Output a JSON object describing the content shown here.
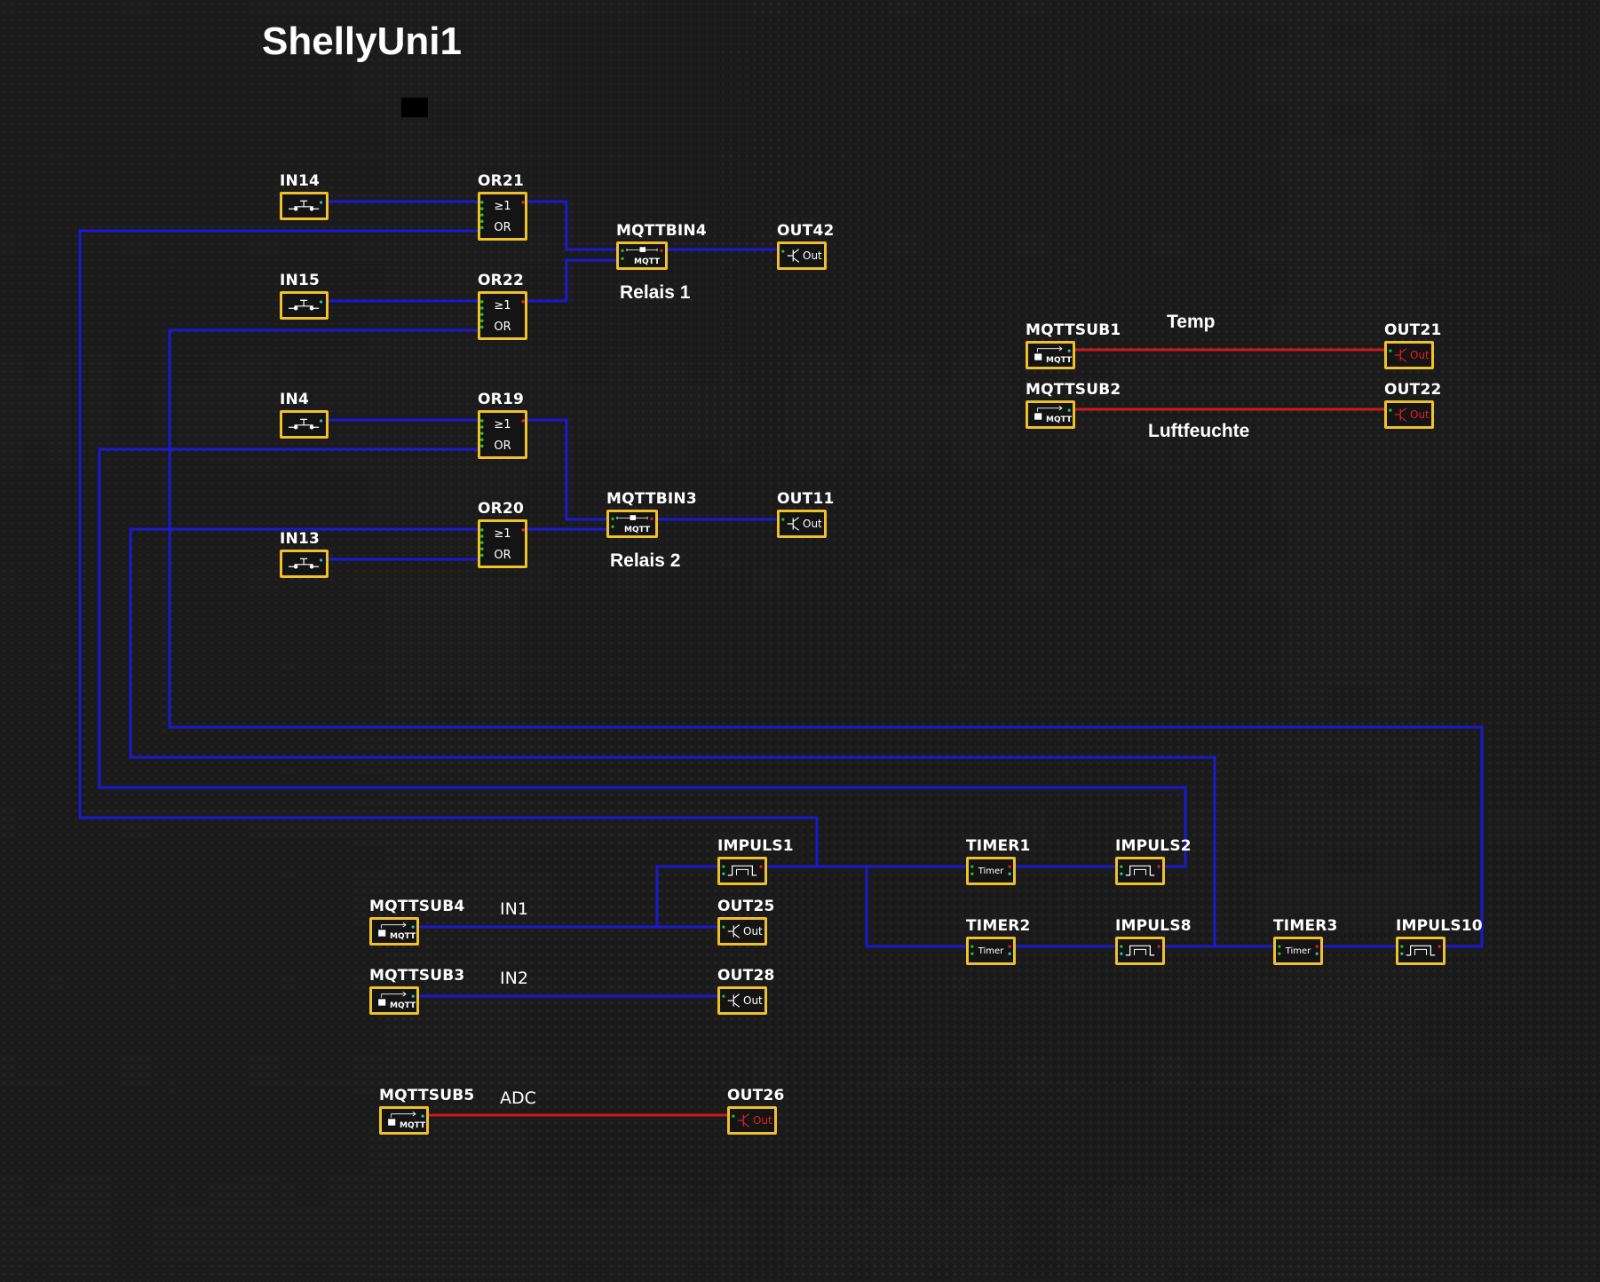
{
  "page_title": "ShellyUni1",
  "blocks": {
    "IN14": {
      "label": "IN14"
    },
    "IN15": {
      "label": "IN15"
    },
    "IN4": {
      "label": "IN4"
    },
    "IN13": {
      "label": "IN13"
    },
    "OR21": {
      "label": "OR21",
      "symbol": "≥1",
      "type": "OR"
    },
    "OR22": {
      "label": "OR22",
      "symbol": "≥1",
      "type": "OR"
    },
    "OR19": {
      "label": "OR19",
      "symbol": "≥1",
      "type": "OR"
    },
    "OR20": {
      "label": "OR20",
      "symbol": "≥1",
      "type": "OR"
    },
    "MQTTBIN4": {
      "label": "MQTTBIN4",
      "tag": "MQTT"
    },
    "MQTTBIN3": {
      "label": "MQTTBIN3",
      "tag": "MQTT"
    },
    "OUT42": {
      "label": "OUT42",
      "tag": "Out"
    },
    "OUT11": {
      "label": "OUT11",
      "tag": "Out"
    },
    "MQTTSUB1": {
      "label": "MQTTSUB1",
      "tag": "MQTT"
    },
    "MQTTSUB2": {
      "label": "MQTTSUB2",
      "tag": "MQTT"
    },
    "OUT21": {
      "label": "OUT21",
      "tag": "Out"
    },
    "OUT22": {
      "label": "OUT22",
      "tag": "Out"
    },
    "IMPULS1": {
      "label": "IMPULS1"
    },
    "IMPULS2": {
      "label": "IMPULS2"
    },
    "IMPULS8": {
      "label": "IMPULS8"
    },
    "IMPULS10": {
      "label": "IMPULS10"
    },
    "TIMER1": {
      "label": "TIMER1",
      "tag": "Timer"
    },
    "TIMER2": {
      "label": "TIMER2",
      "tag": "Timer"
    },
    "TIMER3": {
      "label": "TIMER3",
      "tag": "Timer"
    },
    "MQTTSUB4": {
      "label": "MQTTSUB4",
      "tag": "MQTT"
    },
    "MQTTSUB3": {
      "label": "MQTTSUB3",
      "tag": "MQTT"
    },
    "MQTTSUB5": {
      "label": "MQTTSUB5",
      "tag": "MQTT"
    },
    "OUT25": {
      "label": "OUT25",
      "tag": "Out"
    },
    "OUT28": {
      "label": "OUT28",
      "tag": "Out"
    },
    "OUT26": {
      "label": "OUT26",
      "tag": "Out"
    }
  },
  "captions": {
    "relais1": "Relais 1",
    "relais2": "Relais 2",
    "temp": "Temp",
    "luftfeuchte": "Luftfeuchte",
    "in1": "IN1",
    "in2": "IN2",
    "adc": "ADC"
  },
  "colors": {
    "background": "#1b1b1b",
    "block_border": "#f0c02a",
    "wire_binary": "#1a1acc",
    "wire_analog": "#cc1a1a",
    "port_green": "#25c025",
    "port_red": "#e02020"
  }
}
